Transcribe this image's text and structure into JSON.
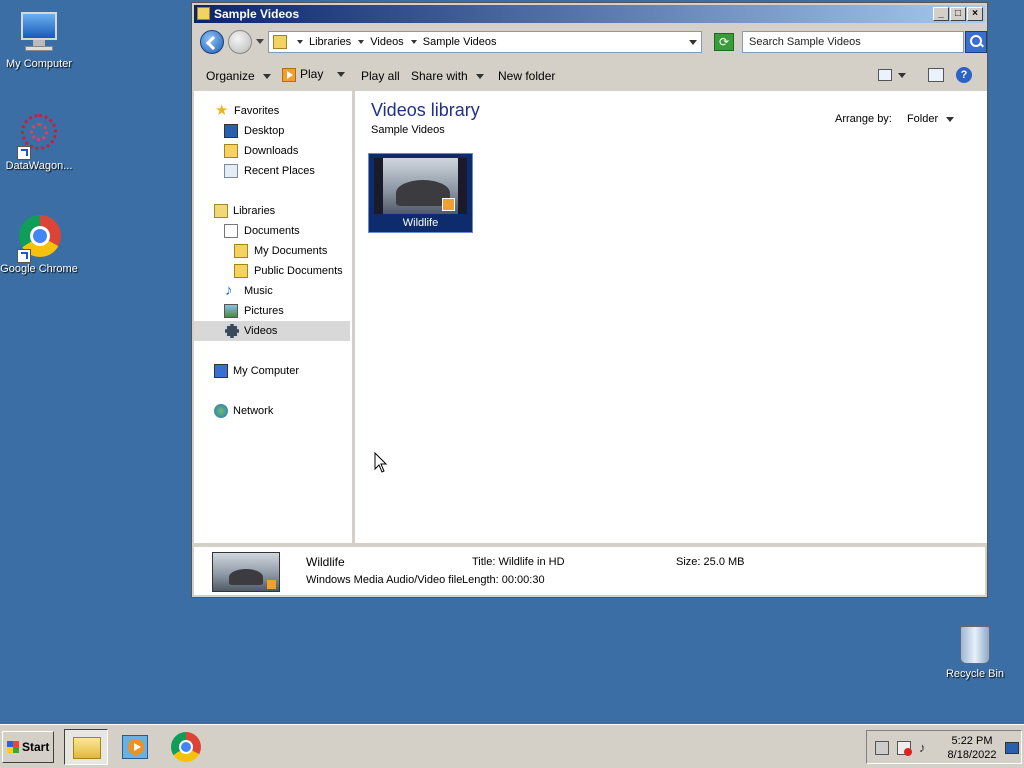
{
  "desktop": {
    "icons": [
      {
        "label": "My Computer"
      },
      {
        "label": "DataWagon..."
      },
      {
        "label": "Google Chrome"
      }
    ],
    "recycle_bin": "Recycle Bin"
  },
  "window": {
    "title": "Sample Videos",
    "controls": {
      "minimize": "_",
      "maximize": "□",
      "close": "×"
    },
    "breadcrumb": [
      "Libraries",
      "Videos",
      "Sample Videos"
    ],
    "search_placeholder": "Search Sample Videos",
    "toolbar": {
      "organize": "Organize",
      "play": "Play",
      "play_all": "Play all",
      "share_with": "Share with",
      "new_folder": "New folder"
    },
    "nav": {
      "favorites": "Favorites",
      "desktop": "Desktop",
      "downloads": "Downloads",
      "recent_places": "Recent Places",
      "libraries": "Libraries",
      "documents": "Documents",
      "my_documents": "My Documents",
      "public_documents": "Public Documents",
      "music": "Music",
      "pictures": "Pictures",
      "videos": "Videos",
      "my_computer": "My Computer",
      "network": "Network"
    },
    "content": {
      "title": "Videos library",
      "subtitle": "Sample Videos",
      "arrange_label": "Arrange by:",
      "arrange_value": "Folder",
      "items": [
        {
          "name": "Wildlife"
        }
      ]
    },
    "details": {
      "name": "Wildlife",
      "type": "Windows Media Audio/Video file",
      "title_label": "Title:",
      "title_value": "Wildlife in HD",
      "length_label": "Length:",
      "length_value": "00:00:30",
      "size_label": "Size:",
      "size_value": "25.0 MB"
    }
  },
  "taskbar": {
    "start": "Start",
    "time": "5:22 PM",
    "date": "8/18/2022"
  },
  "colors": {
    "desktop": "#3a6ea5",
    "titlebar_start": "#0a246a",
    "titlebar_end": "#a6caf0",
    "selection": "#0e2b6e"
  }
}
